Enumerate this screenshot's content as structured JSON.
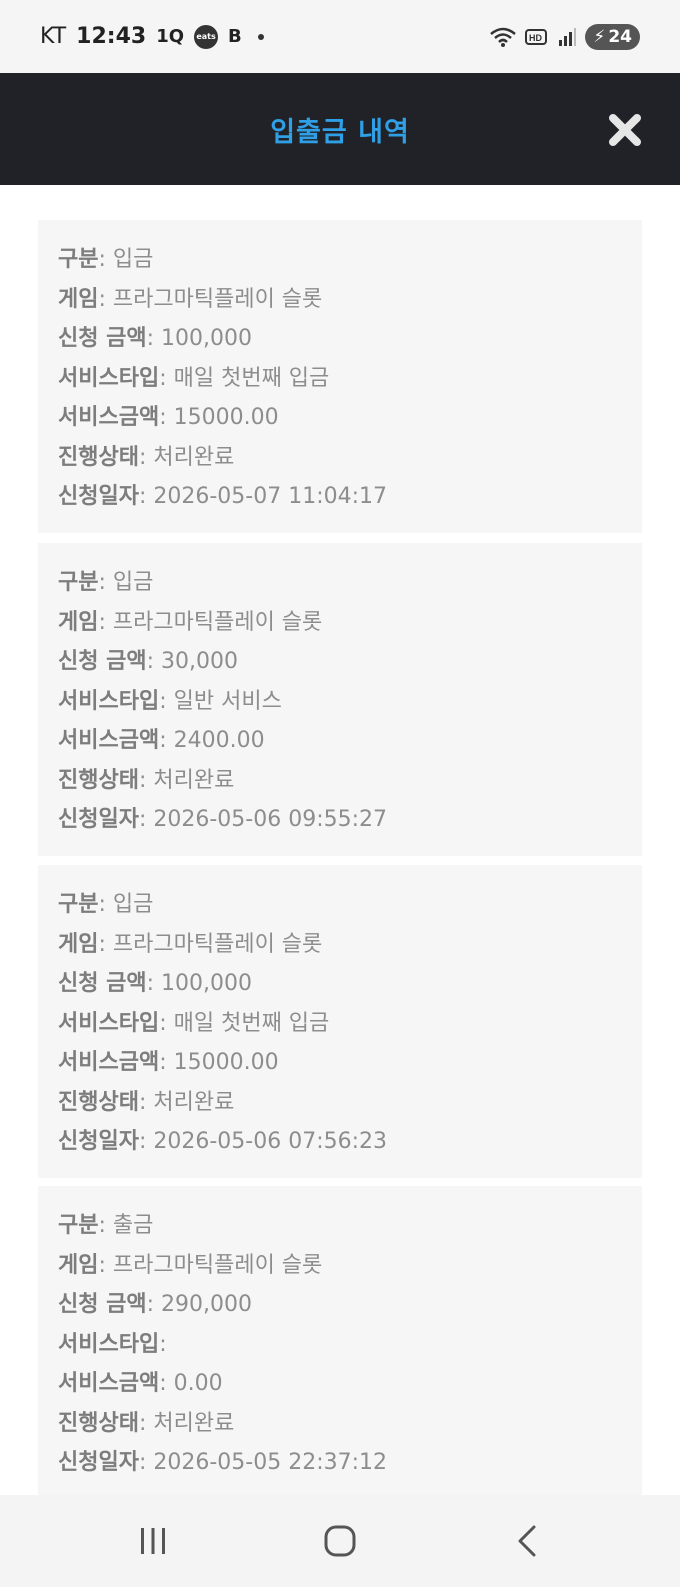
{
  "status_bar": {
    "carrier": "KT",
    "time": "12:43",
    "app_icon_1": "1Q",
    "app_icon_2": "eats",
    "app_icon_3": "B",
    "battery": "24",
    "icons": [
      "wifi-icon",
      "hd-icon",
      "signal-icon",
      "battery-charging-icon"
    ]
  },
  "header": {
    "title": "입출금 내역",
    "close_icon": "close-icon"
  },
  "labels": {
    "type": "구분",
    "game": "게임",
    "amount": "신청 금액",
    "service_type": "서비스타입",
    "service_amount": "서비스금액",
    "status": "진행상태",
    "date": "신청일자"
  },
  "records": [
    {
      "type": "입금",
      "game": "프라그마틱플레이 슬롯",
      "amount": "100,000",
      "service_type": "매일 첫번째 입금",
      "service_amount": "15000.00",
      "status": "처리완료",
      "date": "2026-05-07 11:04:17"
    },
    {
      "type": "입금",
      "game": "프라그마틱플레이 슬롯",
      "amount": "30,000",
      "service_type": "일반 서비스",
      "service_amount": "2400.00",
      "status": "처리완료",
      "date": "2026-05-06 09:55:27"
    },
    {
      "type": "입금",
      "game": "프라그마틱플레이 슬롯",
      "amount": "100,000",
      "service_type": "매일 첫번째 입금",
      "service_amount": "15000.00",
      "status": "처리완료",
      "date": "2026-05-06 07:56:23"
    },
    {
      "type": "출금",
      "game": "프라그마틱플레이 슬롯",
      "amount": "290,000",
      "service_type": "",
      "service_amount": "0.00",
      "status": "처리완료",
      "date": "2026-05-05 22:37:12"
    }
  ],
  "nav": {
    "icons": [
      "recent-apps-icon",
      "home-icon",
      "back-icon"
    ]
  },
  "colors": {
    "header_bg": "#212227",
    "title": "#2f9fe6",
    "card_bg": "#f6f6f7"
  }
}
